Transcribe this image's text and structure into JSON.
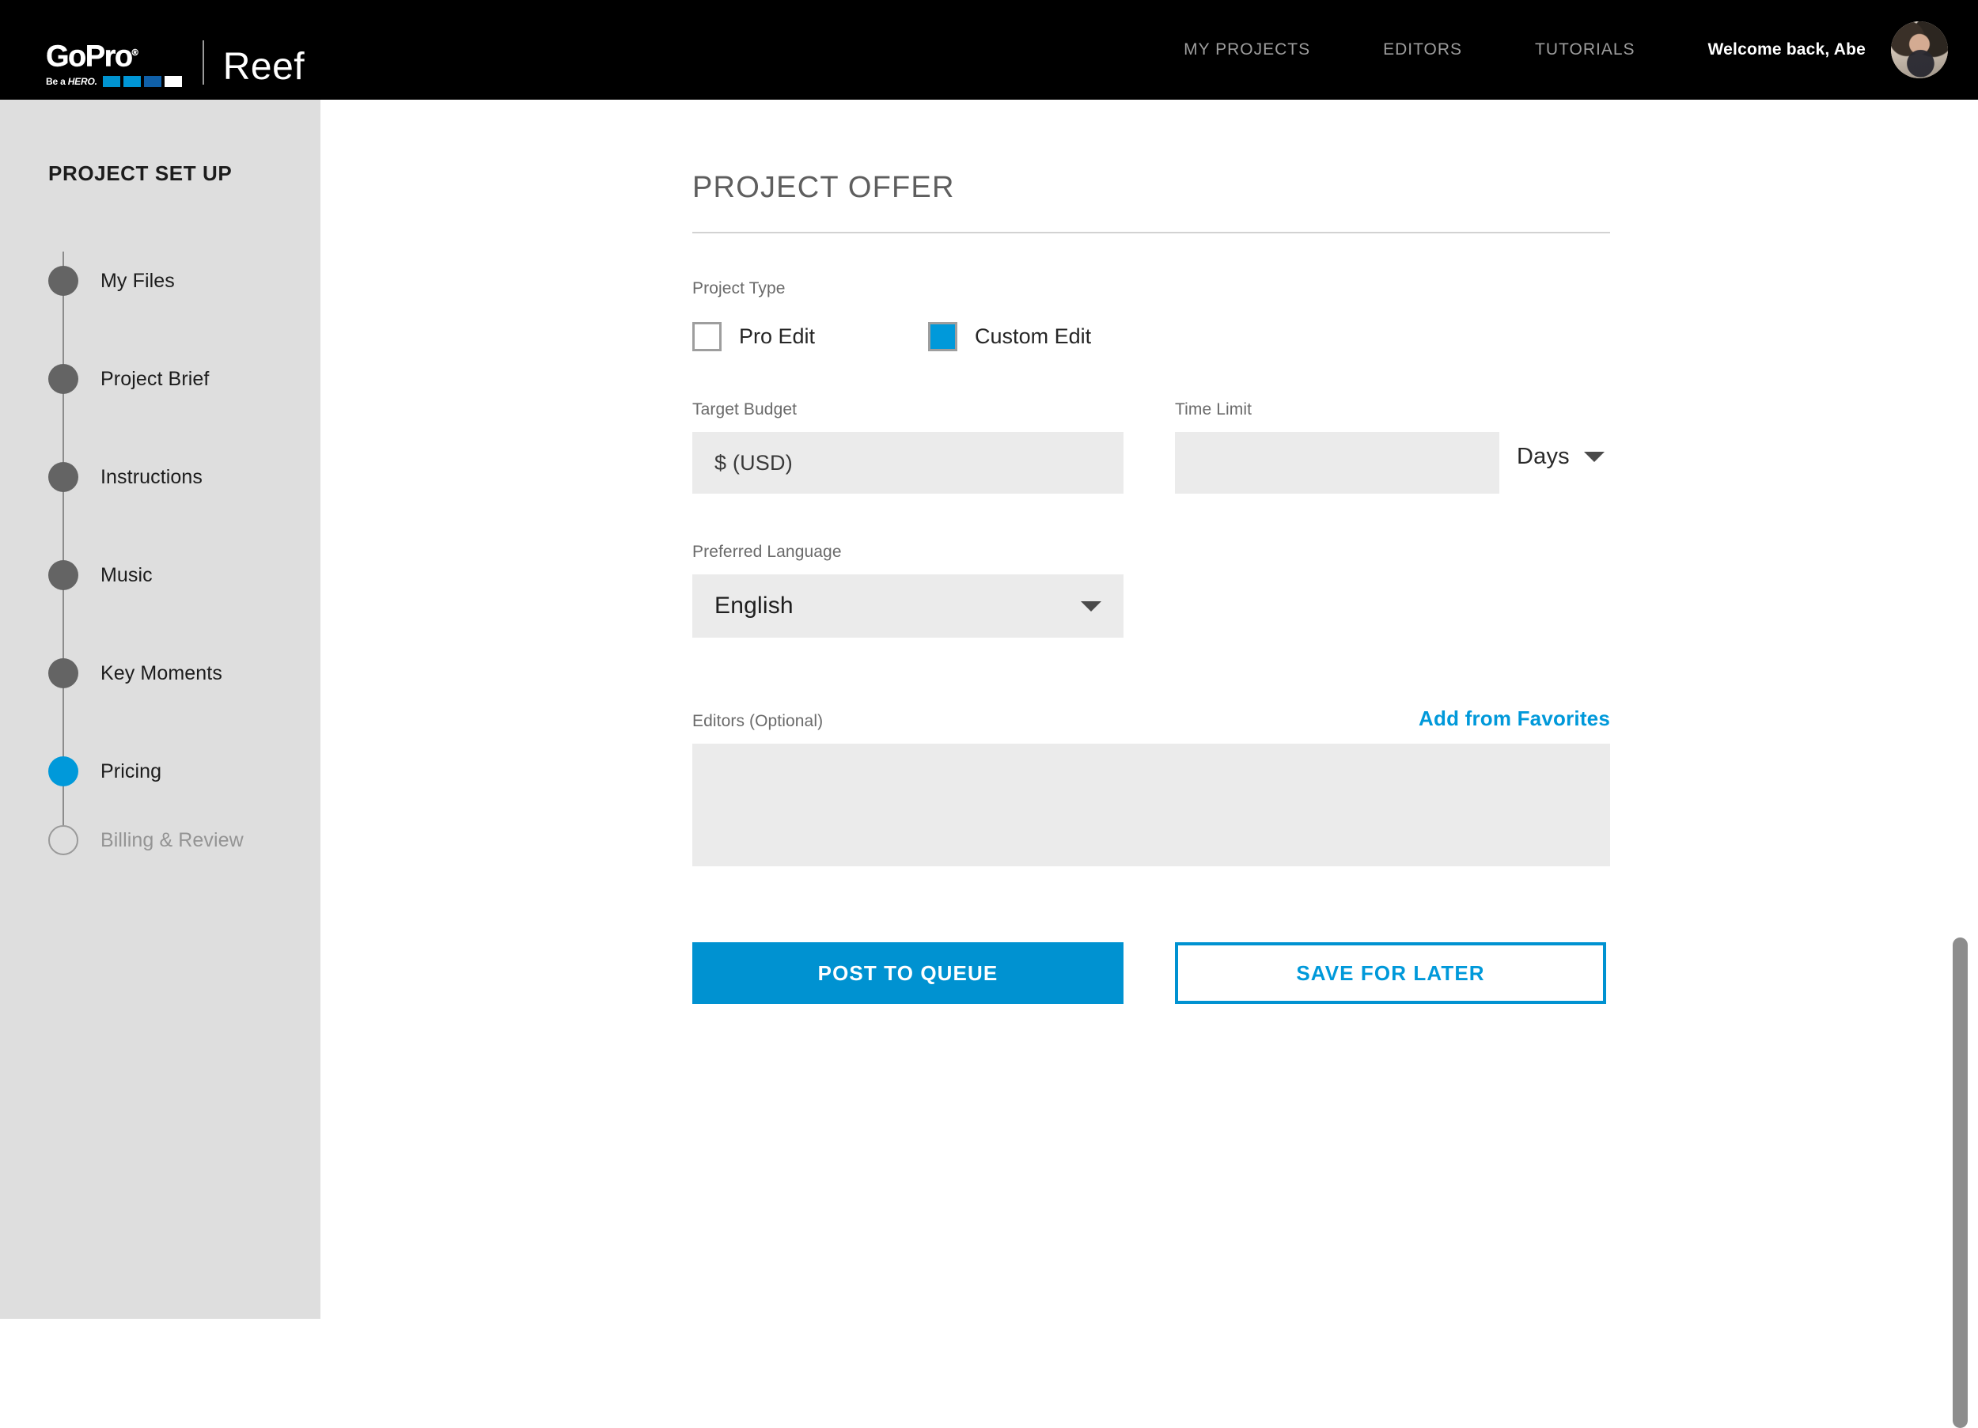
{
  "header": {
    "brand": {
      "wordmark": "GoPro",
      "tagline_prefix": "Be a",
      "tagline_emph": "HERO.",
      "product": "Reef",
      "swatch_colors": [
        "#0093d0",
        "#0096d6",
        "#1060a8",
        "#ffffff"
      ]
    },
    "nav": [
      {
        "label": "MY PROJECTS"
      },
      {
        "label": "EDITORS"
      },
      {
        "label": "TUTORIALS"
      }
    ],
    "welcome": "Welcome back, Abe"
  },
  "sidebar": {
    "title": "PROJECT SET UP",
    "items": [
      {
        "label": "My Files",
        "state": "done"
      },
      {
        "label": "Project Brief",
        "state": "done"
      },
      {
        "label": "Instructions",
        "state": "done"
      },
      {
        "label": "Music",
        "state": "done"
      },
      {
        "label": "Key Moments",
        "state": "done"
      },
      {
        "label": "Pricing",
        "state": "active"
      },
      {
        "label": "Billing & Review",
        "state": "todo"
      }
    ]
  },
  "main": {
    "page_title": "PROJECT OFFER",
    "project_type": {
      "label": "Project Type",
      "options": [
        {
          "label": "Pro Edit",
          "checked": false
        },
        {
          "label": "Custom Edit",
          "checked": true
        }
      ]
    },
    "target_budget": {
      "label": "Target Budget",
      "value": "",
      "placeholder": "$ (USD)"
    },
    "time_limit": {
      "label": "Time Limit",
      "value": "",
      "placeholder": "",
      "unit_selected": "Days"
    },
    "preferred_language": {
      "label": "Preferred Language",
      "selected": "English"
    },
    "editors": {
      "label": "Editors (Optional)",
      "favorites_link": "Add from Favorites",
      "value": ""
    },
    "actions": {
      "primary": "POST TO QUEUE",
      "secondary": "SAVE FOR LATER"
    }
  },
  "colors": {
    "accent_blue": "#0099da",
    "button_blue": "#0092d1",
    "sidebar_bg": "#dedede",
    "field_bg": "#ebebeb",
    "topbar_bg": "#000000"
  }
}
